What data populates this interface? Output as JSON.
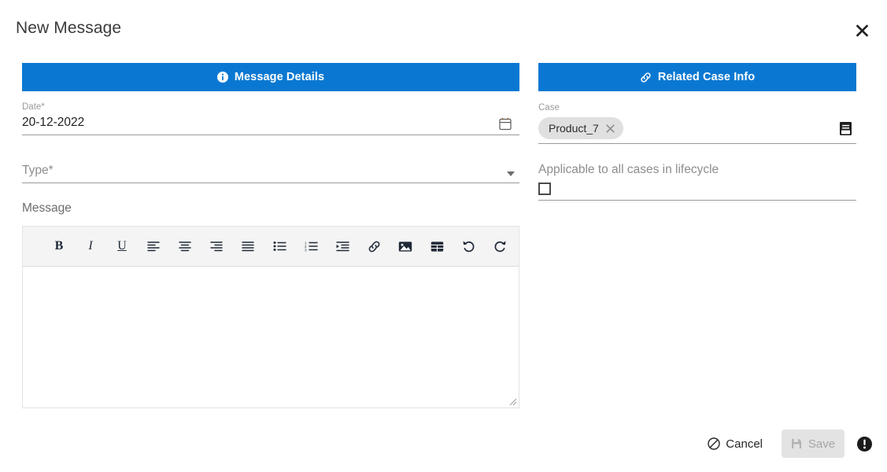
{
  "dialog": {
    "title": "New Message",
    "close_icon": "close-icon"
  },
  "left_panel": {
    "header": {
      "label": "Message Details",
      "icon": "info-circle-icon"
    },
    "date": {
      "label": "Date*",
      "value": "20-12-2022",
      "icon": "calendar-icon"
    },
    "type": {
      "label": "Type*",
      "value": "",
      "icon": "chevron-down-icon"
    },
    "message": {
      "label": "Message",
      "value": "",
      "toolbar": [
        {
          "name": "bold-icon",
          "glyph": "B",
          "title": "Bold"
        },
        {
          "name": "italic-icon",
          "glyph": "I",
          "title": "Italic"
        },
        {
          "name": "underline-icon",
          "glyph": "U",
          "title": "Underline"
        },
        {
          "name": "align-left-icon",
          "glyph": "",
          "title": "Align left"
        },
        {
          "name": "align-center-icon",
          "glyph": "",
          "title": "Align center"
        },
        {
          "name": "align-right-icon",
          "glyph": "",
          "title": "Align right"
        },
        {
          "name": "align-justify-icon",
          "glyph": "",
          "title": "Justify"
        },
        {
          "name": "unordered-list-icon",
          "glyph": "",
          "title": "Bullet list"
        },
        {
          "name": "ordered-list-icon",
          "glyph": "",
          "title": "Numbered list"
        },
        {
          "name": "indent-icon",
          "glyph": "",
          "title": "Indent"
        },
        {
          "name": "link-icon",
          "glyph": "",
          "title": "Insert link"
        },
        {
          "name": "image-icon",
          "glyph": "",
          "title": "Insert image"
        },
        {
          "name": "table-icon",
          "glyph": "",
          "title": "Insert table"
        },
        {
          "name": "undo-icon",
          "glyph": "",
          "title": "Undo"
        },
        {
          "name": "redo-icon",
          "glyph": "",
          "title": "Redo"
        }
      ]
    }
  },
  "right_panel": {
    "header": {
      "label": "Related Case Info",
      "icon": "link-icon"
    },
    "case": {
      "label": "Case",
      "chips": [
        {
          "label": "Product_7",
          "remove_icon": "close-icon"
        }
      ],
      "picker_icon": "list-icon"
    },
    "lifecycle": {
      "label": "Applicable to all cases in lifecycle",
      "checked": false
    }
  },
  "footer": {
    "cancel_label": "Cancel",
    "cancel_icon": "ban-icon",
    "save_label": "Save",
    "save_icon": "floppy-disk-icon",
    "save_disabled": true,
    "info_icon": "exclamation-circle-icon"
  },
  "colors": {
    "panel_header_blue": "#0a78d2",
    "toolbar_bg": "#f4f4f4",
    "chip_bg": "#e0e0e0",
    "save_disabled_bg": "#e3e3e3",
    "underline": "#9a9a9a",
    "text_primary": "#1f1f1f",
    "text_muted": "#8d8d8d"
  }
}
